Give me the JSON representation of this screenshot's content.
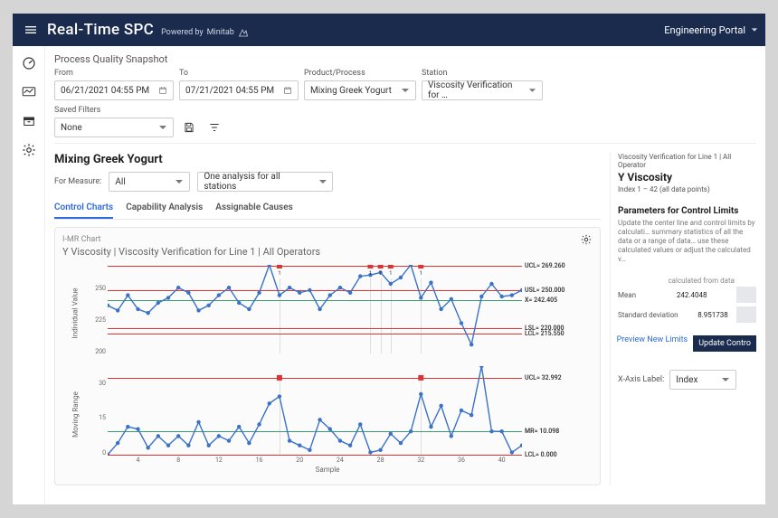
{
  "colors": {
    "topbar": "#1a2b4d",
    "accent": "#2f6bd8",
    "line": "#3a72c7",
    "red": "#d33",
    "green": "#3b9b71"
  },
  "topbar": {
    "brand_main": "Real-Time SPC",
    "brand_sub": "Powered by",
    "brand_name": "Minitab",
    "portal": "Engineering Portal"
  },
  "snapshot": {
    "title": "Process Quality Snapshot"
  },
  "filters": {
    "from_label": "From",
    "to_label": "To",
    "pp_label": "Product/Process",
    "station_label": "Station",
    "from_value": "06/21/2021 04:55 PM",
    "to_value": "07/21/2021 04:55 PM",
    "pp_value": "Mixing Greek Yogurt",
    "station_value": "Viscosity Verification for …",
    "saved_label": "Saved Filters",
    "saved_value": "None"
  },
  "product": {
    "title": "Mixing Greek Yogurt",
    "for_measure_label": "For Measure:",
    "measure_value": "All",
    "analysis_value": "One analysis for all stations"
  },
  "tabs": [
    "Control Charts",
    "Capability Analysis",
    "Assignable Causes"
  ],
  "chart_card": {
    "type_label": "I-MR Chart",
    "title": "Y Viscosity | Viscosity Verification for Line 1 | All Operators",
    "xaxis_label": "Sample"
  },
  "right": {
    "sub": "Viscosity Verification for Line 1 | All Operator",
    "title": "Y Viscosity",
    "range": "Index 1 – 42 (all data points)",
    "params_hdr": "Parameters for Control Limits",
    "params_desc": "Update the center line and control limits by calculati… summary statistics of all the data or a range of data… use these calculated values or adjust the calculated v…",
    "calc_caption": "calculated from data",
    "mean_label": "Mean",
    "mean_val": "242.4048",
    "sd_label": "Standard deviation",
    "sd_val": "8.951738",
    "preview": "Preview New Limits",
    "update": "Update Contro",
    "xaxis_select_label": "X-Axis Label:",
    "xaxis_select_value": "Index"
  },
  "chart_data": [
    {
      "type": "line",
      "name": "Individual Value",
      "ylabel": "Individual Value",
      "ylim": [
        200,
        270
      ],
      "yticks": [
        200,
        225,
        250
      ],
      "lines": [
        {
          "y": 269.26,
          "class": "red",
          "label": "UCL= 269.260"
        },
        {
          "y": 250.0,
          "class": "red",
          "label": "USL= 250.000"
        },
        {
          "y": 242.405,
          "class": "green",
          "label": "X= 242.405"
        },
        {
          "y": 220.0,
          "class": "red",
          "label": "LSL= 220.000"
        },
        {
          "y": 215.55,
          "class": "red",
          "label": "LCL= 215.550"
        }
      ],
      "values": [
        238,
        234,
        246,
        235,
        232,
        240,
        244,
        252,
        248,
        234,
        238,
        246,
        252,
        240,
        235,
        248,
        270,
        246,
        252,
        248,
        250,
        235,
        246,
        252,
        248,
        261,
        262,
        264,
        255,
        260,
        270,
        244,
        256,
        235,
        243,
        224,
        207,
        245,
        255,
        245,
        246,
        250
      ],
      "alarms": [
        {
          "idx": 17,
          "label": "1"
        },
        {
          "idx": 26,
          "label": "1"
        },
        {
          "idx": 27,
          "label": "1"
        },
        {
          "idx": 28,
          "label": "1"
        },
        {
          "idx": 31,
          "label": "1"
        }
      ]
    },
    {
      "type": "line",
      "name": "Moving Range",
      "ylabel": "Moving Range",
      "ylim": [
        0,
        38
      ],
      "yticks": [
        0,
        15,
        30
      ],
      "lines": [
        {
          "y": 32.992,
          "class": "red",
          "label": "UCL= 32.992"
        },
        {
          "y": 10.098,
          "class": "green",
          "label": "MR= 10.098"
        },
        {
          "y": 0.0,
          "class": "red",
          "label": "LCL= 0.000"
        }
      ],
      "values": [
        0,
        5,
        12,
        11,
        3,
        8,
        4,
        8,
        4,
        14,
        4,
        8,
        6,
        12,
        5,
        13,
        22,
        25,
        6,
        4,
        2,
        15,
        11,
        6,
        4,
        13,
        1,
        2,
        9,
        5,
        10,
        26,
        12,
        21,
        8,
        19,
        17,
        38,
        10,
        10,
        1,
        4
      ],
      "alarms": [
        {
          "idx": 17,
          "label": ""
        },
        {
          "idx": 31,
          "label": ""
        }
      ]
    }
  ],
  "x": {
    "ticks": [
      4,
      8,
      12,
      16,
      20,
      24,
      28,
      32,
      36,
      40
    ],
    "n": 42
  }
}
